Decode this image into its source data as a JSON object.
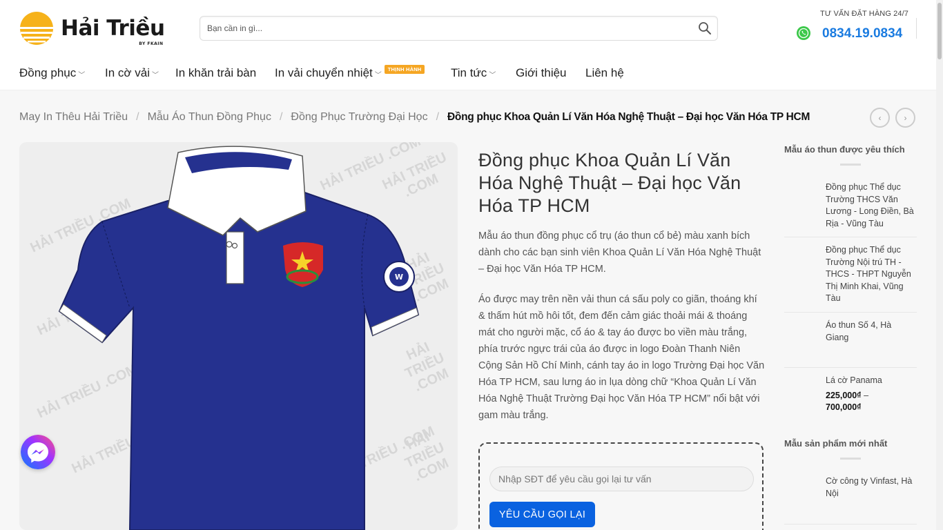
{
  "brand": {
    "name": "Hải Triều",
    "sub": "BY FKAIN",
    "logo_icon": "sun-wave-logo-icon",
    "colors": {
      "sun": "#f6b21a",
      "accent": "#0a62e0"
    }
  },
  "search": {
    "placeholder": "Bạn cần in gì...",
    "icon": "search-icon"
  },
  "hotline": {
    "label": "TƯ VẤN ĐẶT HÀNG 24/7",
    "number": "0834.19.0834",
    "icon": "whatsapp-phone-icon"
  },
  "nav": {
    "items": [
      {
        "label": "Đồng phục",
        "dropdown": true
      },
      {
        "label": "In cờ vải",
        "dropdown": true
      },
      {
        "label": "In khăn trải bàn",
        "dropdown": false
      },
      {
        "label": "In vải chuyển nhiệt",
        "dropdown": true,
        "badge": "THỊNH HÀNH"
      },
      {
        "label": "Tin tức",
        "dropdown": true
      },
      {
        "label": "Giới thiệu",
        "dropdown": false
      },
      {
        "label": "Liên hệ",
        "dropdown": false
      }
    ]
  },
  "breadcrumb": {
    "items": [
      "May In Thêu Hải Triều",
      "Mẫu Áo Thun Đồng Phục",
      "Đồng Phục Trường Đại Học"
    ],
    "separator": "/",
    "current": "Đồng phục Khoa Quản Lí Văn Hóa Nghệ Thuật – Đại học Văn Hóa TP HCM"
  },
  "product_image": {
    "watermark": "HẢI TRIỀU .COM",
    "shirt_color": "#25318f"
  },
  "product": {
    "title": "Đồng phục Khoa Quản Lí Văn Hóa Nghệ Thuật – Đại học Văn Hóa TP HCM",
    "desc_1": "Mẫu áo thun đồng phục cổ trụ (áo thun cổ bẻ) màu xanh bích dành cho các bạn sinh viên Khoa Quản Lí Văn Hóa Nghệ Thuật – Đại học Văn Hóa TP HCM.",
    "desc_2": "Áo được may trên nền vải thun cá sấu poly co giãn, thoáng khí & thấm hút mồ hôi tốt, đem đến cảm giác thoải mái & thoáng mát cho người mặc, cổ áo & tay áo được bo viền màu trắng, phía trước ngực trái của áo được in logo Đoàn Thanh Niên Cộng Sản Hồ Chí Minh, cánh tay áo in logo Trường Đại học Văn Hóa TP HCM, sau lưng áo in lụa dòng chữ “Khoa Quản Lí Văn Hóa Nghệ Thuật Trường Đại học Văn Hóa TP HCM” nổi bật với gam màu trắng."
  },
  "callback": {
    "placeholder": "Nhập SĐT để yêu cầu gọi lại tư vấn",
    "button": "YÊU CẦU GỌI LẠI"
  },
  "sidebar": {
    "popular_title": "Mẫu áo thun được yêu thích",
    "popular": [
      {
        "name": "Đồng phục Thể dục Trường THCS Văn Lương - Long Điền, Bà Rịa - Vũng Tàu"
      },
      {
        "name": "Đồng phục Thể dục Trường Nội trú TH - THCS - THPT Nguyễn Thị Minh Khai, Vũng Tàu"
      },
      {
        "name": "Áo thun Số 4, Hà Giang"
      },
      {
        "name": "Lá cờ Panama",
        "price_from": "225,000₫",
        "price_sep": "–",
        "price_to": "700,000₫"
      }
    ],
    "new_title": "Mẫu sản phẩm mới nhất",
    "new": [
      {
        "name": "Cờ công ty Vinfast, Hà Nội"
      }
    ]
  },
  "messenger": {
    "icon": "messenger-icon"
  }
}
